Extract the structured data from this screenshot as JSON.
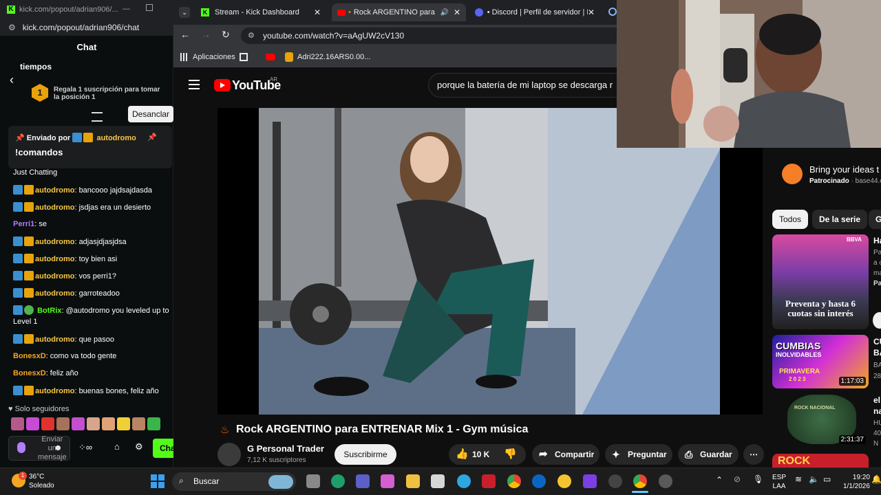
{
  "chat_window": {
    "title_url": "kick.com/popout/adrian906/...",
    "url": "kick.com/popout/adrian906/chat",
    "header": "Chat",
    "top_text": "tiempos",
    "gift_rank": "1",
    "gift_text_1": "Regala 1 suscripción para tomar",
    "gift_text_2": "la posición 1",
    "tooltip": "Desanclar",
    "pinned_label": "Enviado por",
    "pinned_user": "autodromo",
    "pinned_message": "!comandos",
    "category": "Just Chatting",
    "messages": [
      {
        "user": "autodromo",
        "text": ": bancooo jajdsajdasda",
        "color": "gold",
        "badges": true
      },
      {
        "user": "autodromo",
        "text": ": jsdjas era un desierto",
        "color": "gold",
        "badges": true
      },
      {
        "user": "Perri1",
        "text": ": se",
        "color": "purple",
        "badges": false
      },
      {
        "user": "autodromo",
        "text": ": adjasjdjasjdsa",
        "color": "gold",
        "badges": true
      },
      {
        "user": "autodromo",
        "text": ": toy bien asi",
        "color": "gold",
        "badges": true
      },
      {
        "user": "autodromo",
        "text": ": vos perri1?",
        "color": "gold",
        "badges": true
      },
      {
        "user": "autodromo",
        "text": ": garroteadoo",
        "color": "gold",
        "badges": true
      }
    ],
    "botrix_user": "BotRix",
    "botrix_text": ": @autodromo you leveled up to",
    "botrix_text2": "Level 1",
    "messages2": [
      {
        "user": "autodromo",
        "text": ": que pasoo",
        "color": "gold",
        "badges": true
      },
      {
        "user": "BonesxD",
        "text": ": como va todo gente",
        "color": "orange",
        "badges": false
      },
      {
        "user": "BonesxD",
        "text": ": feliz año",
        "color": "orange",
        "badges": false
      },
      {
        "user": "autodromo",
        "text": ": buenas bones, feliz año",
        "color": "gold",
        "badges": true
      }
    ],
    "followers_only": "Solo seguidores",
    "input_placeholder_1": "Enviar",
    "input_placeholder_2": "un",
    "input_placeholder_3": "mensaje",
    "send_label": "Cha"
  },
  "tabs": [
    {
      "label": "Stream - Kick Dashboard"
    },
    {
      "label": "Rock ARGENTINO para"
    },
    {
      "label": "• Discord | Perfil de servidor | E"
    }
  ],
  "address": "youtube.com/watch?v=aAgUW2cV130",
  "bookmarks": {
    "apps": "Aplicaciones",
    "item": "Adri222.16ARS0.00..."
  },
  "youtube": {
    "logo": "YouTube",
    "region": "AR",
    "search_value": "porque la batería de mi laptop se descarga r",
    "title": "Rock ARGENTINO para ENTRENAR Mix 1 - Gym música",
    "channel": "G Personal Trader",
    "subscribers": "7,12 K suscriptores",
    "subscribe": "Suscribirme",
    "likes": "10 K",
    "share": "Compartir",
    "ask": "Preguntar",
    "save": "Guardar",
    "ad_title": "Bring your ideas t",
    "ad_sponsored": "Patrocinado",
    "ad_domain": "· base44.co",
    "chips": [
      "Todos",
      "De la serie",
      "G"
    ],
    "rec1_overlay_1": "Preventa y hasta 6",
    "rec1_overlay_2": "cuotas sin interés",
    "rec1_brand": "BBVA",
    "rec1_title": "Ha",
    "rec1_meta": [
      "Pa",
      "a c",
      "ma",
      "Pa"
    ],
    "rec2_banner_1": "CUMBIAS",
    "rec2_banner_2": "INOLVIDABLES",
    "rec2_banner_3": "PRIMAVERA",
    "rec2_banner_4": "2 0 2 3",
    "rec2_duration": "1:17:03",
    "rec2_title": [
      "CU",
      "BA"
    ],
    "rec2_meta": [
      "BA",
      "28"
    ],
    "rec3_duration": "2:31:37",
    "rec3_title": [
      "el",
      "na"
    ],
    "rec3_meta": [
      "HU",
      "40",
      "N"
    ],
    "rec3_art": "ROCK NACIONAL",
    "rec4_art": "ROCK"
  },
  "taskbar": {
    "temp": "36°C",
    "weather": "Soleado",
    "weather_badge": "1",
    "search": "Buscar",
    "lang_1": "ESP",
    "lang_2": "LAA",
    "time": "19:20",
    "date": "1/1/2026"
  }
}
